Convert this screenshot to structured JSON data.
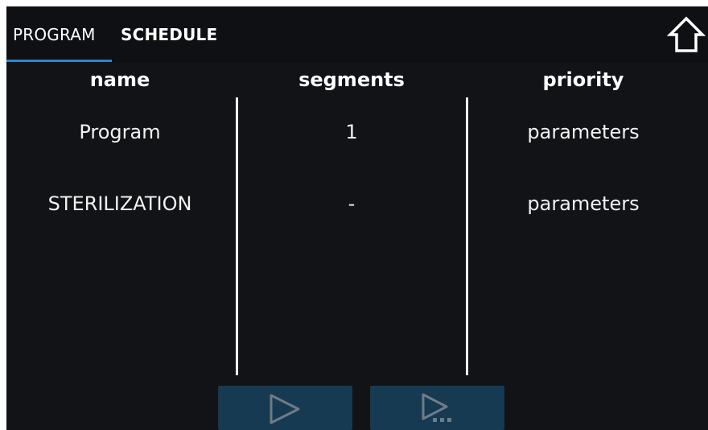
{
  "tabs": [
    {
      "label": "PROGRAM",
      "active": true
    },
    {
      "label": "SCHEDULE",
      "active": false
    }
  ],
  "home_icon": "home-icon",
  "table": {
    "headers": {
      "name": "name",
      "segments": "segments",
      "priority": "priority"
    },
    "rows": [
      {
        "name": "Program",
        "segments": "1",
        "priority": "parameters"
      },
      {
        "name": "STERILIZATION",
        "segments": "-",
        "priority": "parameters"
      }
    ]
  },
  "actions": [
    {
      "icon": "play-icon",
      "enabled": false
    },
    {
      "icon": "play-more-icon",
      "enabled": false
    }
  ],
  "colors": {
    "background": "#121317",
    "accent": "#2c86c6",
    "button_disabled": "#153a52",
    "icon_disabled": "#6f7c86"
  }
}
